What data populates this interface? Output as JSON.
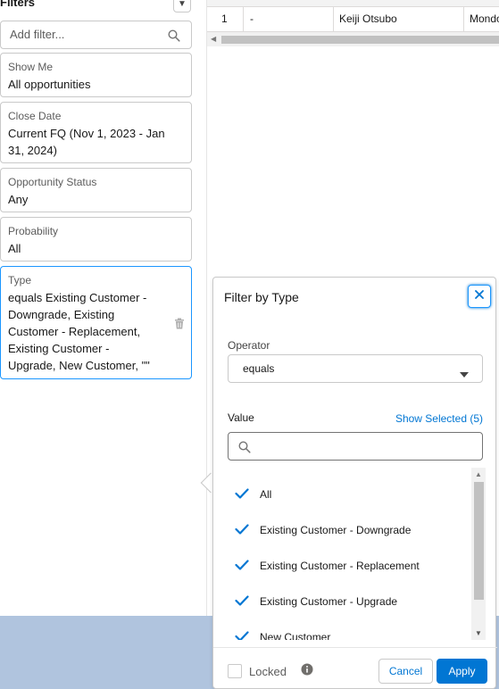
{
  "filters_panel": {
    "title": "Filters",
    "add_filter_placeholder": "Add filter...",
    "cards": [
      {
        "label": "Show Me",
        "value": "All opportunities"
      },
      {
        "label": "Close Date",
        "value": "Current FQ (Nov 1, 2023 - Jan 31, 2024)"
      },
      {
        "label": "Opportunity Status",
        "value": "Any"
      },
      {
        "label": "Probability",
        "value": "All"
      },
      {
        "label": "Type",
        "value": "equals Existing Customer - Downgrade, Existing Customer - Replacement, Existing Customer - Upgrade, New Customer, \"\""
      }
    ]
  },
  "table": {
    "row": {
      "number": "1",
      "col2": "-",
      "owner": "Keiji Otsubo",
      "account": "Mondo"
    }
  },
  "popover": {
    "title": "Filter by Type",
    "operator_label": "Operator",
    "operator_value": "equals",
    "value_label": "Value",
    "show_selected": "Show Selected (5)",
    "search_placeholder": "",
    "options": [
      {
        "label": "All",
        "checked": true
      },
      {
        "label": "Existing Customer - Downgrade",
        "checked": true
      },
      {
        "label": "Existing Customer - Replacement",
        "checked": true
      },
      {
        "label": "Existing Customer - Upgrade",
        "checked": true
      },
      {
        "label": "New Customer",
        "checked": true
      }
    ],
    "locked_label": "Locked",
    "cancel_label": "Cancel",
    "apply_label": "Apply"
  },
  "colors": {
    "brand_blue": "#0176d3",
    "focus_blue": "#1b96ff",
    "bottom_band": "#b0c4de"
  },
  "icons": [
    "chevron-down-icon",
    "search-icon",
    "trash-icon",
    "close-icon",
    "caret-down-icon",
    "check-icon",
    "info-icon"
  ]
}
